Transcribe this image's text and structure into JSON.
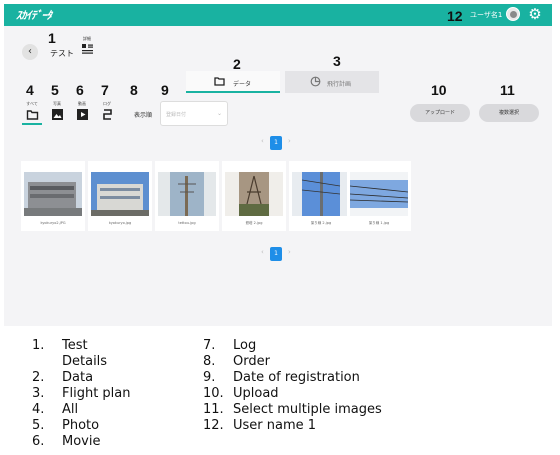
{
  "header": {
    "logo": "ｽｶｲﾃﾞｰﾀ",
    "user_name": "ユーザ名1"
  },
  "toolbar": {
    "back": "‹",
    "title": "テスト",
    "details_caption": "詳細"
  },
  "tabs": [
    {
      "label": "データ"
    },
    {
      "label": "飛行計画"
    }
  ],
  "filters": [
    {
      "caption": "すべて",
      "icon": "folder-icon"
    },
    {
      "caption": "写真",
      "icon": "photo-icon"
    },
    {
      "caption": "動画",
      "icon": "movie-icon"
    },
    {
      "caption": "ログ",
      "icon": "log-icon"
    }
  ],
  "order": {
    "label": "表示順",
    "placeholder": "登録日付"
  },
  "buttons": {
    "upload": "アップロード",
    "multi_select": "複数選択"
  },
  "pagination": {
    "prev": "‹",
    "current": "1",
    "next": "›"
  },
  "images": [
    {
      "name": "kyokuryo2.JPG"
    },
    {
      "name": "kyokuryo.jpg"
    },
    {
      "name": "tettou.jpg"
    },
    {
      "name": "鉄塔 2.jpg"
    },
    {
      "name": "架り線 2.jpg"
    },
    {
      "name": "架り線 1.jpg"
    }
  ],
  "callouts": [
    "1",
    "2",
    "3",
    "4",
    "5",
    "6",
    "7",
    "8",
    "9",
    "10",
    "11",
    "12"
  ],
  "legend_left": [
    {
      "n": "1.",
      "t": "Test"
    },
    {
      "n": "",
      "t": "Details"
    },
    {
      "n": "2.",
      "t": "Data"
    },
    {
      "n": "3.",
      "t": "Flight plan"
    },
    {
      "n": "4.",
      "t": "All"
    },
    {
      "n": "5.",
      "t": "Photo"
    },
    {
      "n": "6.",
      "t": "Movie"
    }
  ],
  "legend_right": [
    {
      "n": "7.",
      "t": "Log"
    },
    {
      "n": "8.",
      "t": "Order"
    },
    {
      "n": "9.",
      "t": "Date of registration"
    },
    {
      "n": "10.",
      "t": "Upload"
    },
    {
      "n": "11.",
      "t": "Select multiple images"
    },
    {
      "n": "12.",
      "t": "User name 1"
    }
  ],
  "colors": {
    "accent": "#19b2a1",
    "page_active": "#1e8ee8"
  }
}
